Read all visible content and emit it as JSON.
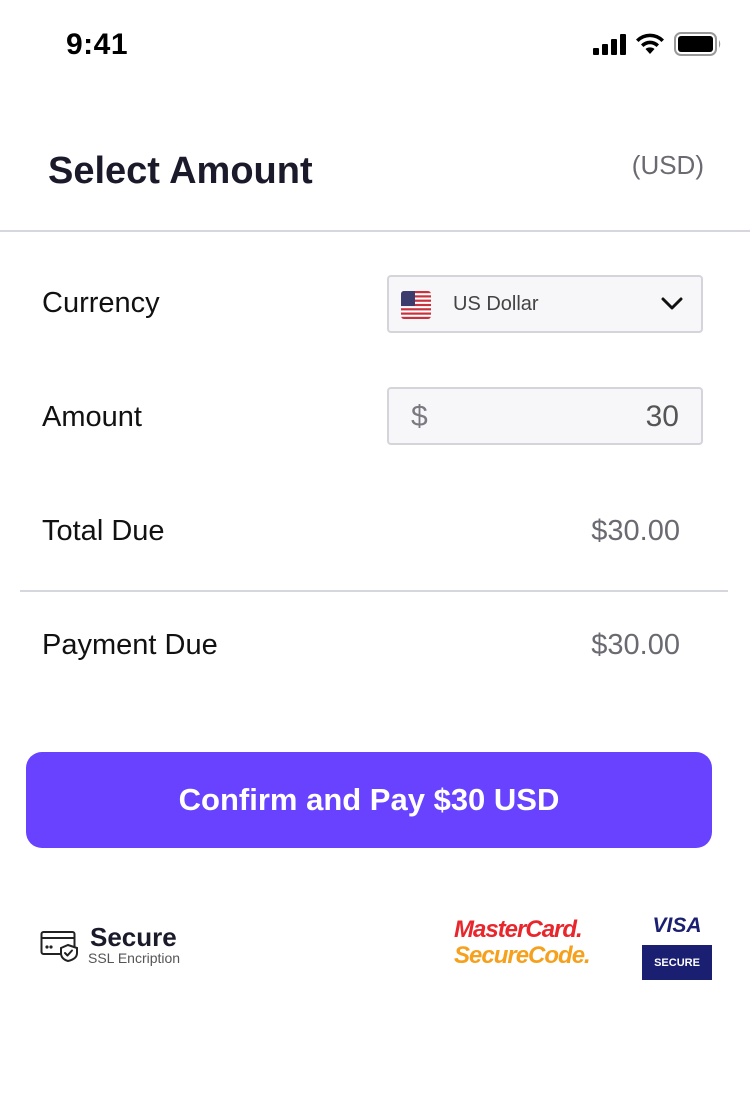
{
  "status_bar": {
    "time": "9:41"
  },
  "header": {
    "title": "Select Amount",
    "currency_code": "(USD)"
  },
  "currency": {
    "label": "Currency",
    "selected": "US Dollar"
  },
  "amount": {
    "label": "Amount",
    "symbol": "$",
    "value": "30"
  },
  "total_due": {
    "label": "Total Due",
    "value": "$30.00"
  },
  "payment_due": {
    "label": "Payment Due",
    "value": "$30.00"
  },
  "confirm_button": {
    "label": "Confirm and Pay $30 USD"
  },
  "footer": {
    "secure_title": "Secure",
    "secure_subtitle": "SSL Encription",
    "mastercard_line1": "MasterCard.",
    "mastercard_line2": "SecureCode.",
    "visa_word": "VISA",
    "visa_secure": "SECURE"
  },
  "colors": {
    "accent": "#6842ff",
    "visa_blue": "#1a1f71",
    "mc_red": "#e8262c",
    "mc_orange": "#f6a11d"
  }
}
